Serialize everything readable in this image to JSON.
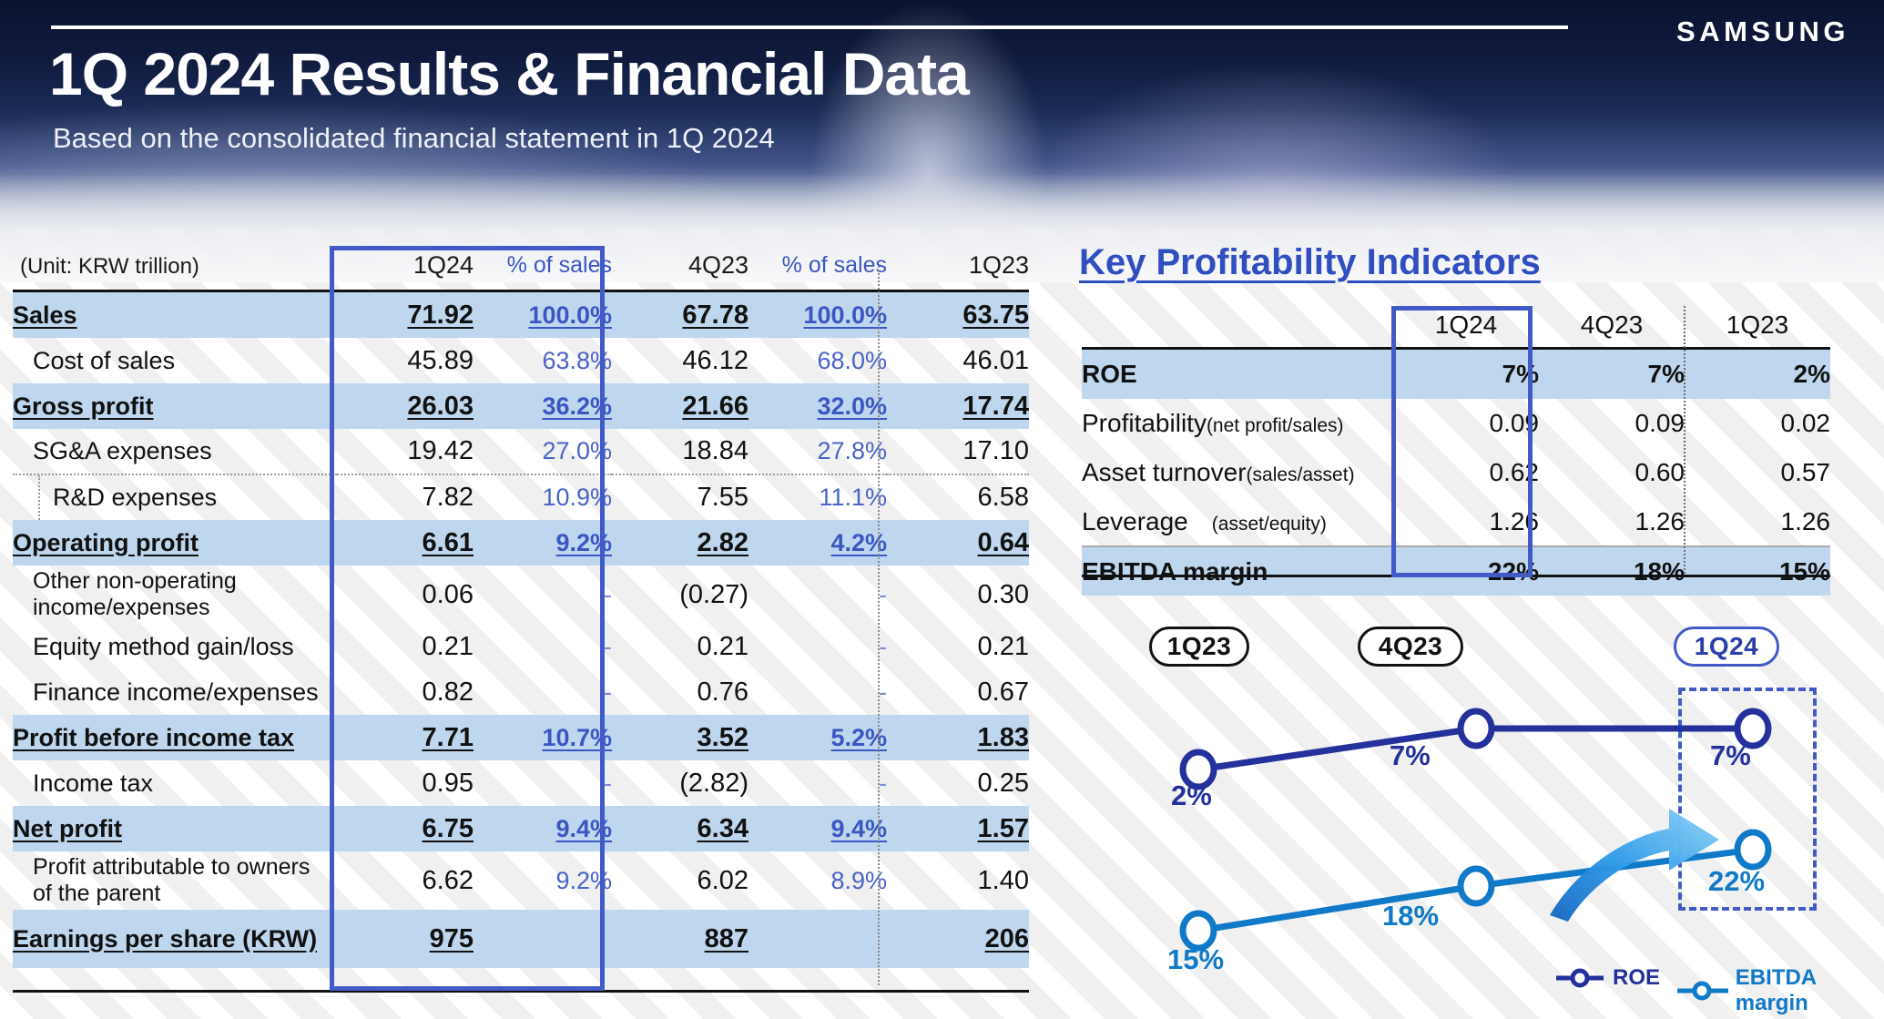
{
  "header": {
    "title": "1Q 2024 Results & Financial Data",
    "subtitle": "Based on the consolidated financial statement in 1Q 2024",
    "logo": "SAMSUNG"
  },
  "fin_table": {
    "unit_label": "(Unit: KRW trillion)",
    "columns": [
      "1Q24",
      "% of sales",
      "4Q23",
      "% of sales",
      "1Q23"
    ],
    "rows": [
      {
        "label": "Sales",
        "v1": "71.92",
        "p1": "100.0%",
        "v2": "67.78",
        "p2": "100.0%",
        "v3": "63.75"
      },
      {
        "label": "Cost of sales",
        "v1": "45.89",
        "p1": "63.8%",
        "v2": "46.12",
        "p2": "68.0%",
        "v3": "46.01"
      },
      {
        "label": "Gross profit",
        "v1": "26.03",
        "p1": "36.2%",
        "v2": "21.66",
        "p2": "32.0%",
        "v3": "17.74"
      },
      {
        "label": "SG&A expenses",
        "v1": "19.42",
        "p1": "27.0%",
        "v2": "18.84",
        "p2": "27.8%",
        "v3": "17.10"
      },
      {
        "label": "R&D expenses",
        "v1": "7.82",
        "p1": "10.9%",
        "v2": "7.55",
        "p2": "11.1%",
        "v3": "6.58"
      },
      {
        "label": "Operating profit",
        "v1": "6.61",
        "p1": "9.2%",
        "v2": "2.82",
        "p2": "4.2%",
        "v3": "0.64"
      },
      {
        "label": "Other non-operating income/expenses",
        "v1": "0.06",
        "p1": "-",
        "v2": "(0.27)",
        "p2": "-",
        "v3": "0.30"
      },
      {
        "label": "Equity method gain/loss",
        "v1": "0.21",
        "p1": "-",
        "v2": "0.21",
        "p2": "-",
        "v3": "0.21"
      },
      {
        "label": "Finance income/expenses",
        "v1": "0.82",
        "p1": "-",
        "v2": "0.76",
        "p2": "-",
        "v3": "0.67"
      },
      {
        "label": "Profit before income tax",
        "v1": "7.71",
        "p1": "10.7%",
        "v2": "3.52",
        "p2": "5.2%",
        "v3": "1.83"
      },
      {
        "label": "Income tax",
        "v1": "0.95",
        "p1": "-",
        "v2": "(2.82)",
        "p2": "-",
        "v3": "0.25"
      },
      {
        "label": "Net profit",
        "v1": "6.75",
        "p1": "9.4%",
        "v2": "6.34",
        "p2": "9.4%",
        "v3": "1.57"
      },
      {
        "label": "Profit attributable to owners of the parent",
        "v1": "6.62",
        "p1": "9.2%",
        "v2": "6.02",
        "p2": "8.9%",
        "v3": "1.40"
      },
      {
        "label": "Earnings per share (KRW)",
        "v1": "975",
        "p1": "",
        "v2": "887",
        "p2": "",
        "v3": "206"
      }
    ],
    "label_line1_other": "Other non-operating",
    "label_line2_other": "income/expenses",
    "label_line1_parent": "Profit attributable to owners",
    "label_line2_parent": "of the parent"
  },
  "kpi": {
    "title": "Key Profitability Indicators",
    "columns": [
      "1Q24",
      "4Q23",
      "1Q23"
    ],
    "rows": [
      {
        "name": "ROE",
        "sub": "",
        "v1": "7%",
        "v2": "7%",
        "v3": "2%"
      },
      {
        "name": "Profitability",
        "sub": "(net profit/sales)",
        "v1": "0.09",
        "v2": "0.09",
        "v3": "0.02"
      },
      {
        "name": "Asset turnover",
        "sub": "(sales/asset)",
        "v1": "0.62",
        "v2": "0.60",
        "v3": "0.57"
      },
      {
        "name": "Leverage",
        "sub": "(asset/equity)",
        "v1": "1.26",
        "v2": "1.26",
        "v3": "1.26"
      },
      {
        "name": "EBITDA margin",
        "sub": "",
        "v1": "22%",
        "v2": "18%",
        "v3": "15%"
      }
    ]
  },
  "chart_data": {
    "type": "line",
    "title": "",
    "categories": [
      "1Q23",
      "4Q23",
      "1Q24"
    ],
    "series": [
      {
        "name": "ROE",
        "values": [
          2,
          7,
          7
        ],
        "labels": [
          "2%",
          "7%",
          "7%"
        ],
        "color": "#24309b"
      },
      {
        "name": "EBITDA margin",
        "values": [
          15,
          18,
          22
        ],
        "labels": [
          "15%",
          "18%",
          "22%"
        ],
        "color": "#1079c8"
      }
    ],
    "legend": [
      "ROE",
      "EBITDA margin"
    ],
    "legend_position": "bottom-right",
    "grid": false,
    "ylabel": "",
    "xlabel": "",
    "annotations": [
      "growth-arrow",
      "1Q24-highlight-box"
    ]
  },
  "colors": {
    "accent_blue": "#4259c8",
    "band_blue": "#bfd7ee",
    "roe_navy": "#24309b",
    "ebitda_blue": "#1079c8",
    "pct_blue": "#4a63c9"
  }
}
